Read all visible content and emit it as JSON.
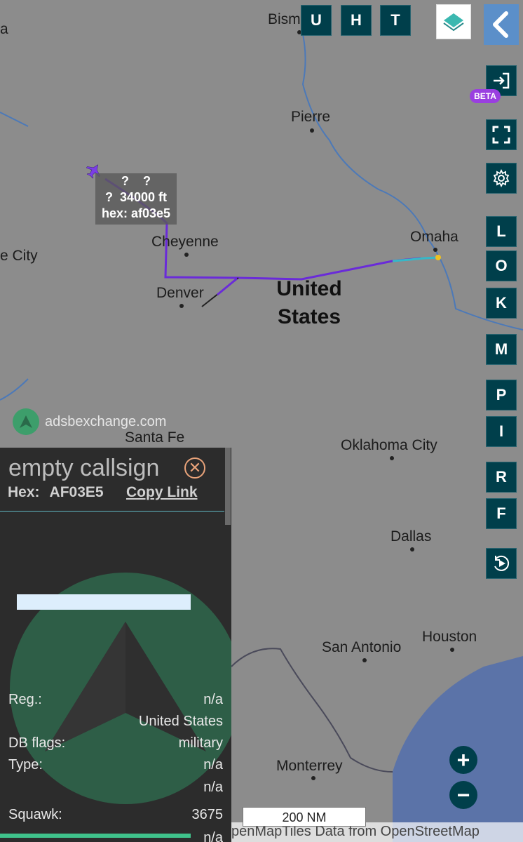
{
  "map": {
    "cities": [
      {
        "name": "Bism"
      },
      {
        "name": "Pierre"
      },
      {
        "name": "Cheyenne"
      },
      {
        "name": "Denver"
      },
      {
        "name": "Omaha"
      },
      {
        "name": "e City"
      },
      {
        "name": "Santa Fe"
      },
      {
        "name": "Oklahoma City"
      },
      {
        "name": "Dallas"
      },
      {
        "name": "San Antonio"
      },
      {
        "name": "Houston"
      },
      {
        "name": "Monterrey"
      },
      {
        "name": "a"
      }
    ],
    "country_label": {
      "line1": "United",
      "line2": "States"
    },
    "aircraft_label": {
      "line1": "?    ?",
      "line2": "?  34000 ft",
      "line3": "hex: af03e5"
    },
    "watermark": "adsbexchange.com",
    "scale": "200 NM",
    "attribution": "penMapTiles Data from OpenStreetMap"
  },
  "toolbar": {
    "top": [
      "U",
      "H",
      "T"
    ],
    "beta": "BETA",
    "side": [
      "L",
      "O",
      "K",
      "M",
      "P",
      "I",
      "R",
      "F"
    ]
  },
  "panel": {
    "callsign": "empty callsign",
    "hex_label": "Hex:",
    "hex_value": "AF03E5",
    "copy_link": "Copy Link",
    "rows": [
      {
        "key": "Reg.:",
        "value": "n/a"
      },
      {
        "key": "",
        "value": "United States"
      },
      {
        "key": "DB flags:",
        "value": "military"
      },
      {
        "key": "Type:",
        "value": "n/a"
      },
      {
        "key": "",
        "value": "n/a"
      },
      {
        "key": "Squawk:",
        "value": "3675"
      },
      {
        "key": "",
        "value": "n/a"
      }
    ]
  },
  "colors": {
    "button_bg": "#003f4b",
    "track_purple": "#6a2bd9",
    "beta_badge": "#9a3fe0",
    "panel_bg": "#2c2c2c",
    "water": "#5b73a8"
  },
  "icons": [
    "layers-icon",
    "back-icon",
    "login-icon",
    "fullscreen-icon",
    "settings-icon",
    "replay-icon",
    "zoom-in-icon",
    "zoom-out-icon",
    "airplane-icon",
    "close-icon",
    "adsbx-logo-icon"
  ]
}
